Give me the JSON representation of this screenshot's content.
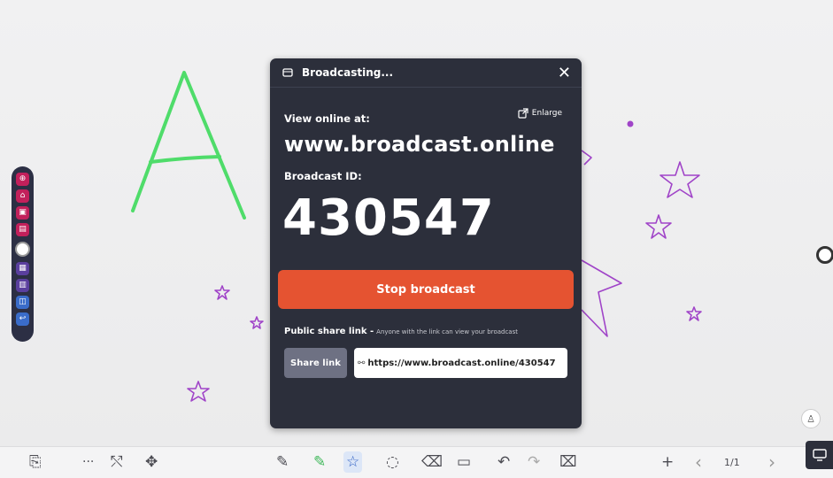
{
  "modal": {
    "title": "Broadcasting...",
    "close_glyph": "✕",
    "view_label": "View online at:",
    "enlarge_label": "Enlarge",
    "url": "www.broadcast.online",
    "id_label": "Broadcast ID:",
    "broadcast_id": "430547",
    "stop_label": "Stop broadcast",
    "share_title": "Public share link -",
    "share_subtitle": "Anyone with the link can view your broadcast",
    "share_button": "Share link",
    "share_url": "https://www.broadcast.online/430547",
    "footer_left": "",
    "footer_right": ""
  },
  "toolbar": {
    "page_indicator": "1/1",
    "more_glyph": "···",
    "plus_glyph": "+",
    "prev_glyph": "‹",
    "next_glyph": "›"
  },
  "colors": {
    "modal_bg": "#2c2f3b",
    "stop_button": "#e55331",
    "letter_stroke": "#4fdc6a",
    "star_stroke": "#a044c8",
    "rail_bg": "#2c2f44"
  }
}
